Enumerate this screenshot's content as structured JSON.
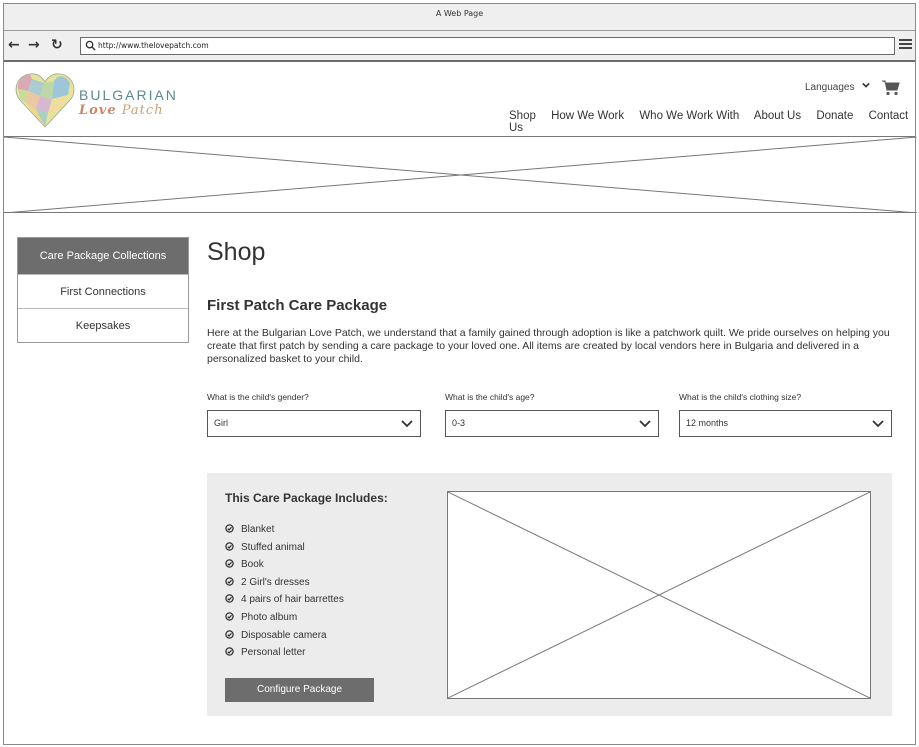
{
  "window": {
    "title": "A Web Page"
  },
  "browser": {
    "url": "http://www.thelovepatch.com",
    "back_icon": "arrow-left-icon",
    "forward_icon": "arrow-right-icon",
    "reload_icon": "reload-icon",
    "menu_icon": "hamburger-menu-icon"
  },
  "header": {
    "logo_line1": "BULGARIAN",
    "logo_line2_bold": "Love",
    "logo_line2_rest": " Patch",
    "languages": "Languages",
    "nav": [
      "Shop",
      "How We Work",
      "Who We Work With",
      "About Us",
      "Donate",
      "Contact Us"
    ]
  },
  "sidebar": {
    "items": [
      {
        "label": "Care Package Collections",
        "active": true
      },
      {
        "label": "First Connections",
        "active": false
      },
      {
        "label": "Keepsakes",
        "active": false
      }
    ]
  },
  "main": {
    "title": "Shop",
    "section_title": "First Patch Care Package",
    "intro": "Here at the Bulgarian Love Patch, we understand that a family gained through adoption is like a patchwork quilt. We pride ourselves on helping you create that first patch by sending a care package to your loved one. All items are created by local vendors here in Bulgaria and delivered in a personalized basket to your child.",
    "fields": [
      {
        "label": "What is the child's gender?",
        "value": "Girl"
      },
      {
        "label": "What is the child's age?",
        "value": "0-3"
      },
      {
        "label": "What is the child's clothing size?",
        "value": "12 months"
      }
    ]
  },
  "package": {
    "title": "This Care Package Includes:",
    "items": [
      "Blanket",
      "Stuffed animal",
      "Book",
      "2 Girl's dresses",
      "4 pairs of hair barrettes",
      "Photo album",
      "Disposable camera",
      "Personal letter"
    ],
    "button": "Configure Package"
  },
  "colors": {
    "active_bg": "#6d6d6d",
    "panel_bg": "#ececec",
    "logo_blue": "#5a8a96",
    "logo_tan": "#c9a36c"
  }
}
